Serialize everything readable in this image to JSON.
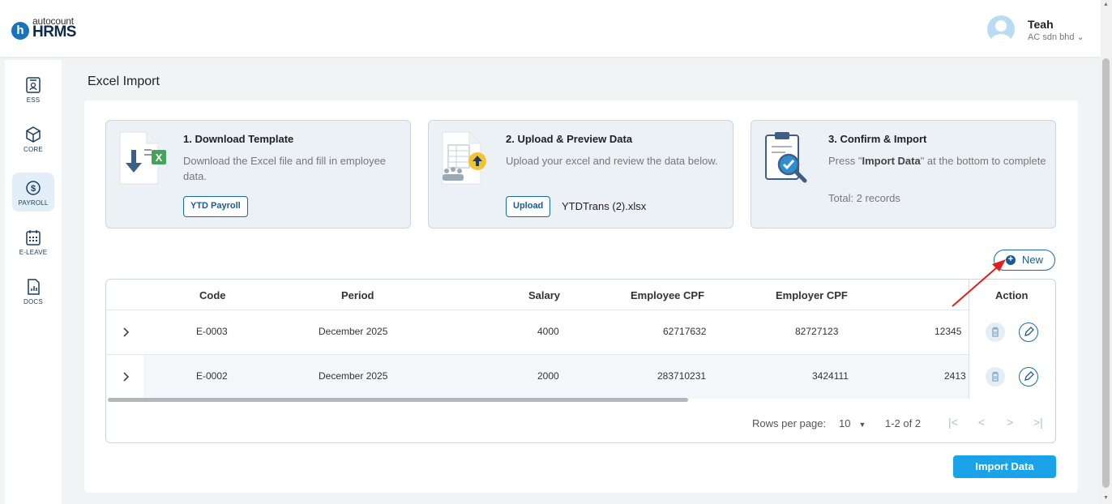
{
  "app": {
    "logo_small": "autocount",
    "logo_big": "HRMS"
  },
  "user": {
    "name": "Teah",
    "company": "AC sdn bhd"
  },
  "sidebar": {
    "items": [
      {
        "label": "ESS"
      },
      {
        "label": "CORE"
      },
      {
        "label": "PAYROLL",
        "active": true
      },
      {
        "label": "E-LEAVE"
      },
      {
        "label": "DOCS"
      }
    ]
  },
  "page": {
    "title": "Excel Import"
  },
  "steps": [
    {
      "title": "1. Download Template",
      "desc": "Download the Excel file and fill in employee data.",
      "button": "YTD Payroll"
    },
    {
      "title": "2. Upload & Preview Data",
      "desc": "Upload your excel and review the data below.",
      "button": "Upload",
      "file": "YTDTrans (2).xlsx"
    },
    {
      "title": "3. Confirm & Import",
      "desc_pre": "Press \"",
      "desc_bold": "Import Data",
      "desc_post": "\" at the bottom to complete",
      "total": "Total: 2 records"
    }
  ],
  "new_button": "New",
  "table": {
    "headers": {
      "code": "Code",
      "period": "Period",
      "salary": "Salary",
      "employee_cpf": "Employee CPF",
      "employer_cpf": "Employer CPF",
      "action": "Action"
    },
    "rows": [
      {
        "code": "E-0003",
        "period": "December 2025",
        "salary": "4000",
        "employee_cpf": "62717632",
        "employer_cpf": "82727123",
        "extra": "12345"
      },
      {
        "code": "E-0002",
        "period": "December 2025",
        "salary": "2000",
        "employee_cpf": "283710231",
        "employer_cpf": "3424111",
        "extra": "2413"
      }
    ]
  },
  "pagination": {
    "rows_label": "Rows per page:",
    "rows_value": "10",
    "range": "1-2 of 2"
  },
  "import_button": "Import Data",
  "colors": {
    "primary": "#1a6aa8",
    "accent": "#1aa3e8",
    "annotation": "#e02020"
  }
}
